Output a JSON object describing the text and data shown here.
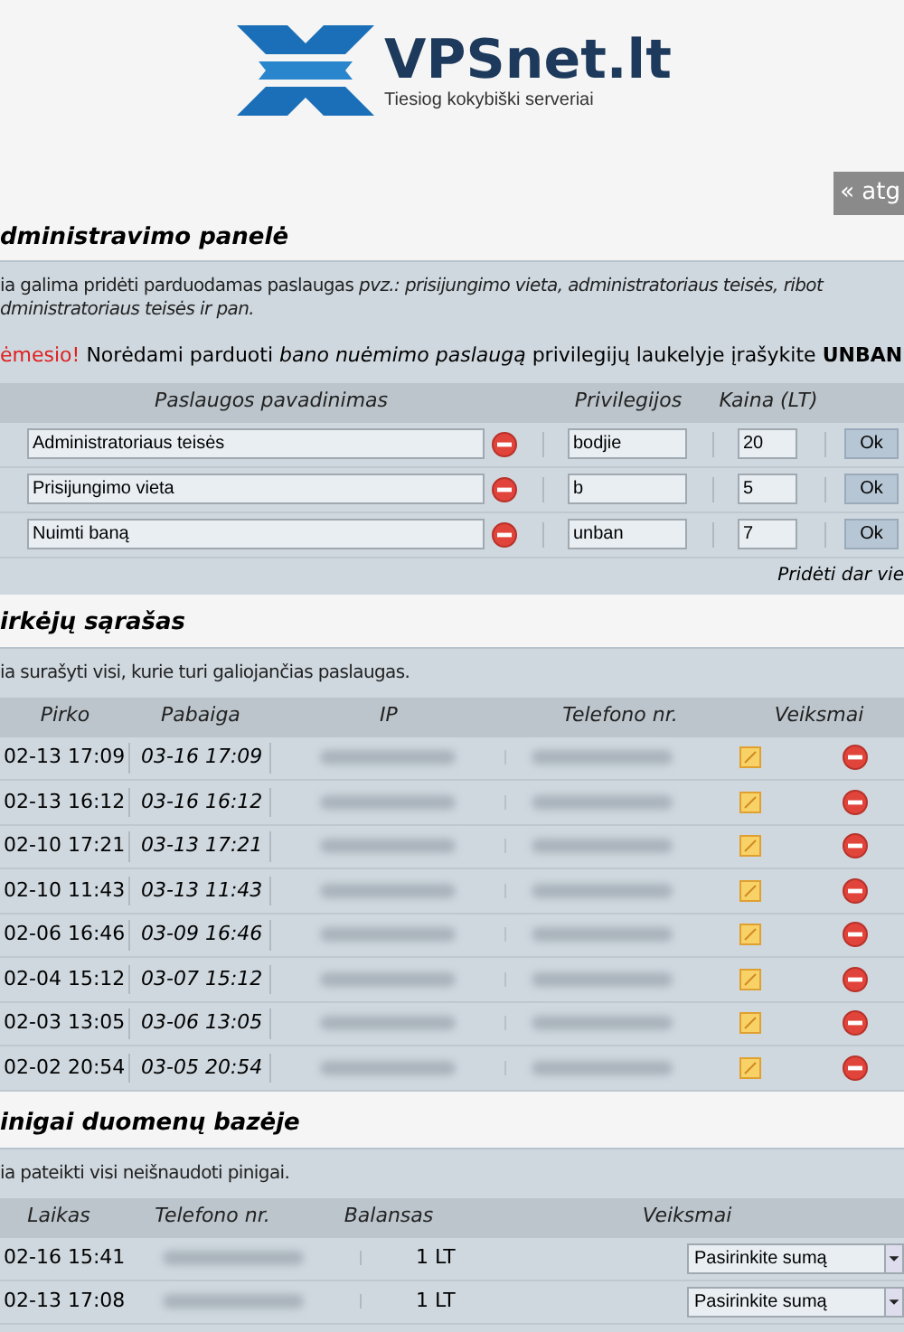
{
  "logo": {
    "name": "VPSnet.lt",
    "tagline": "Tiesiog kokybiški serveriai"
  },
  "back_button": "« atg",
  "admin": {
    "title": "dministravimo panelė",
    "intro": "ia galima pridėti parduodamas paslaugas *pvz.: prisijungimo vieta, administratoriaus teisės, ribot*\n*dministratoriaus teisės ir pan.*",
    "warning_label": "ėmesio!",
    "warning": "Norėdami parduoti *bano nuėmimo paslaugą* privilegijų laukelyje įrašykite **UNBAN**",
    "columns": [
      "Paslaugos pavadinimas",
      "Privilegijos",
      "Kaina (LT)"
    ],
    "rows": [
      {
        "name": "Administratoriaus teisės",
        "privileges": "bodjie",
        "price": "20",
        "button": "Ok"
      },
      {
        "name": "Prisijungimo vieta",
        "privileges": "b",
        "price": "5",
        "button": "Ok"
      },
      {
        "name": "Nuimti baną",
        "privileges": "unban",
        "price": "7",
        "button": "Ok"
      }
    ],
    "add_link": "Pridėti dar vie"
  },
  "buyers": {
    "title": "irkėjų sąrašas",
    "intro": "ia surašyti visi, kurie turi galiojančias paslaugas.",
    "columns": [
      "Pirko",
      "Pabaiga",
      "IP",
      "Telefono nr.",
      "Veiksmai"
    ],
    "rows": [
      {
        "bought": "02-13 17:09",
        "ends": "03-16 17:09"
      },
      {
        "bought": "02-13 16:12",
        "ends": "03-16 16:12"
      },
      {
        "bought": "02-10 17:21",
        "ends": "03-13 17:21"
      },
      {
        "bought": "02-10 11:43",
        "ends": "03-13 11:43"
      },
      {
        "bought": "02-06 16:46",
        "ends": "03-09 16:46"
      },
      {
        "bought": "02-04 15:12",
        "ends": "03-07 15:12"
      },
      {
        "bought": "02-03 13:05",
        "ends": "03-06 13:05"
      },
      {
        "bought": "02-02 20:54",
        "ends": "03-05 20:54"
      }
    ]
  },
  "money": {
    "title": "inigai duomenų bazėje",
    "intro": "ia pateikti visi neišnaudoti pinigai.",
    "columns": [
      "Laikas",
      "Telefono nr.",
      "Balansas",
      "Veiksmai"
    ],
    "rows": [
      {
        "time": "02-16 15:41",
        "balance": "1 LT",
        "select": "Pasirinkite sumą"
      },
      {
        "time": "02-13 17:08",
        "balance": "1 LT",
        "select": "Pasirinkite sumą"
      }
    ]
  }
}
